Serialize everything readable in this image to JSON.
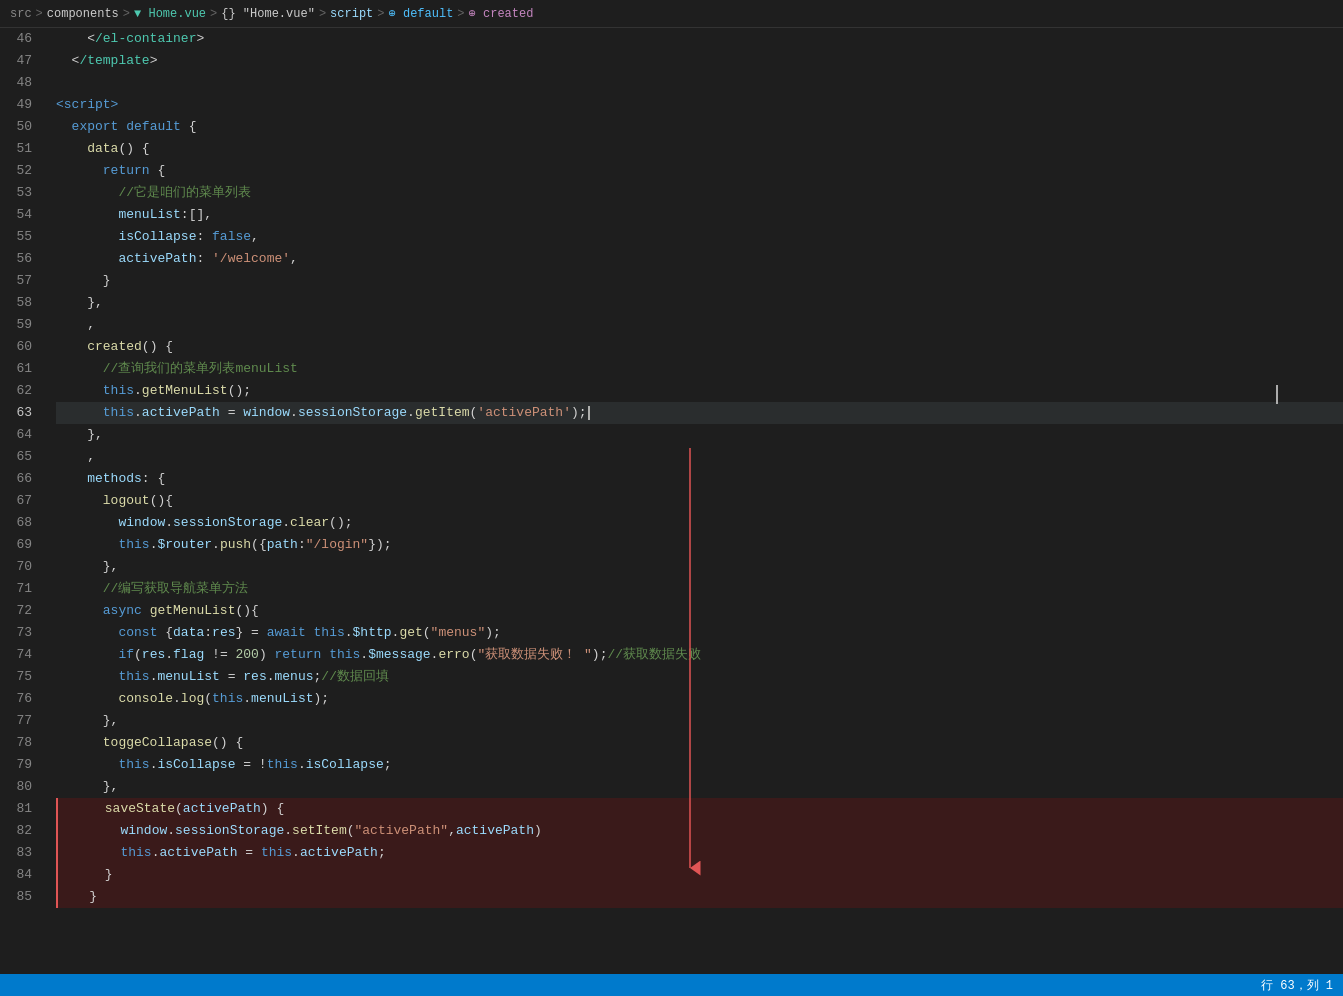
{
  "breadcrumb": {
    "items": [
      {
        "label": "src",
        "type": "plain"
      },
      {
        "label": ">",
        "type": "sep"
      },
      {
        "label": "components",
        "type": "plain"
      },
      {
        "label": ">",
        "type": "sep"
      },
      {
        "label": "▼ Home.vue",
        "type": "vue"
      },
      {
        "label": ">",
        "type": "sep"
      },
      {
        "label": "{} \"Home.vue\"",
        "type": "plain"
      },
      {
        "label": ">",
        "type": "sep"
      },
      {
        "label": "script",
        "type": "script"
      },
      {
        "label": ">",
        "type": "sep"
      },
      {
        "label": "⊕ default",
        "type": "default"
      },
      {
        "label": ">",
        "type": "sep"
      },
      {
        "label": "⊕ created",
        "type": "created"
      }
    ]
  },
  "lines": [
    {
      "num": 46,
      "content": "    </el-container>"
    },
    {
      "num": 47,
      "content": "  </template>"
    },
    {
      "num": 48,
      "content": ""
    },
    {
      "num": 49,
      "content": "<script>"
    },
    {
      "num": 50,
      "content": "  export default {"
    },
    {
      "num": 51,
      "content": "    data() {"
    },
    {
      "num": 52,
      "content": "      return {"
    },
    {
      "num": 53,
      "content": "        //它是咱们的菜单列表"
    },
    {
      "num": 54,
      "content": "        menuList:[],"
    },
    {
      "num": 55,
      "content": "        isCollapse: false,"
    },
    {
      "num": 56,
      "content": "        activePath: '/welcome',"
    },
    {
      "num": 57,
      "content": "      }"
    },
    {
      "num": 58,
      "content": "    },"
    },
    {
      "num": 59,
      "content": "    ,"
    },
    {
      "num": 60,
      "content": "    created() {"
    },
    {
      "num": 61,
      "content": "      //查询我们的菜单列表menuList"
    },
    {
      "num": 62,
      "content": "      this.getMenuList();"
    },
    {
      "num": 63,
      "content": "      this.activePath = window.sessionStorage.getItem('activePath');",
      "active": true
    },
    {
      "num": 64,
      "content": "    },"
    },
    {
      "num": 65,
      "content": "    ,"
    },
    {
      "num": 66,
      "content": "    methods: {"
    },
    {
      "num": 67,
      "content": "      logout(){"
    },
    {
      "num": 68,
      "content": "        window.sessionStorage.clear();"
    },
    {
      "num": 69,
      "content": "        this.$router.push({path:\"/login\"});"
    },
    {
      "num": 70,
      "content": "      },"
    },
    {
      "num": 71,
      "content": "      //编写获取导航菜单方法"
    },
    {
      "num": 72,
      "content": "      async getMenuList(){"
    },
    {
      "num": 73,
      "content": "        const {data:res} = await this.$http.get(\"menus\");"
    },
    {
      "num": 74,
      "content": "        if(res.flag != 200) return this.$message.erro(\"获取数据失败！\");//获取数据失败"
    },
    {
      "num": 75,
      "content": "        this.menuList = res.menus;//数据回填"
    },
    {
      "num": 76,
      "content": "        console.log(this.menuList);"
    },
    {
      "num": 77,
      "content": "      },"
    },
    {
      "num": 78,
      "content": "      toggeCollapase() {"
    },
    {
      "num": 79,
      "content": "        this.isCollapse = !this.isCollapse;"
    },
    {
      "num": 80,
      "content": "      },"
    },
    {
      "num": 81,
      "content": "      saveState(activePath) {",
      "highlighted": true
    },
    {
      "num": 82,
      "content": "        window.sessionStorage.setItem(\"activePath\",activePath)",
      "highlighted": true
    },
    {
      "num": 83,
      "content": "        this.activePath = this.activePath;",
      "highlighted": true
    },
    {
      "num": 84,
      "content": "      }",
      "highlighted": true
    },
    {
      "num": 85,
      "content": "    }",
      "highlighted": true
    }
  ],
  "status_bar": {
    "position": "行 63，列 1"
  }
}
